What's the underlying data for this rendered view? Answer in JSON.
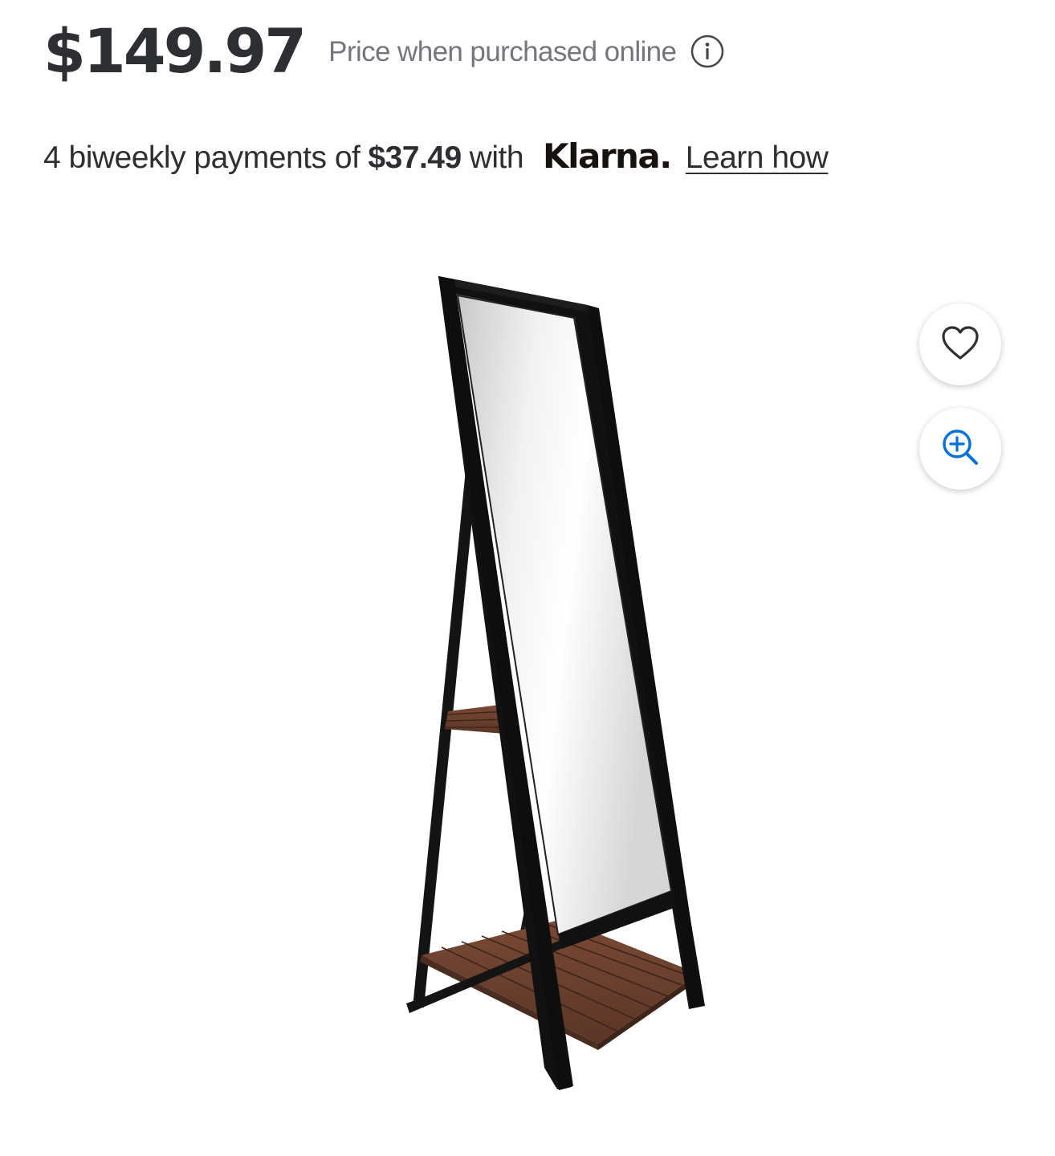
{
  "price": {
    "amount": "$149.97",
    "note": "Price when purchased online",
    "info_icon": "info-circle-icon"
  },
  "financing": {
    "prefix": "4 biweekly payments of",
    "amount": "$37.49",
    "with": "with",
    "provider": "Klarna.",
    "link": "Learn how"
  },
  "product_image": {
    "icon": "standing-mirror-with-shelves"
  },
  "actions": {
    "favorite_icon": "heart-icon",
    "zoom_icon": "zoom-in-icon",
    "accent_color": "#0071dc"
  }
}
